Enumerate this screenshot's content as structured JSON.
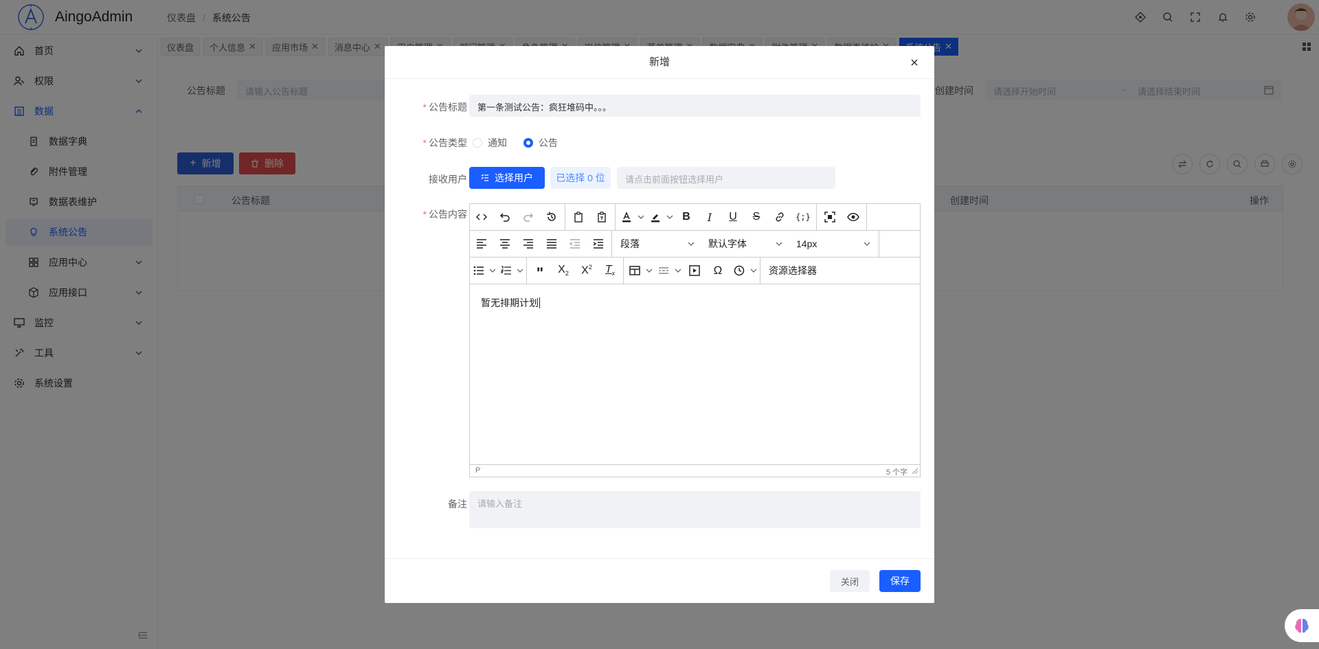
{
  "app": {
    "name": "AingoAdmin"
  },
  "breadcrumb": {
    "root": "仪表盘",
    "sep": "/",
    "current": "系统公告"
  },
  "header_icons": [
    "gitee-icon",
    "search-icon",
    "fullscreen-icon",
    "bell-icon",
    "gear-icon"
  ],
  "sidebar": {
    "items": [
      {
        "label": "首页",
        "icon": "home-icon"
      },
      {
        "label": "权限",
        "icon": "user-key-icon"
      },
      {
        "label": "数据",
        "icon": "list-icon"
      },
      {
        "label": "数据字典",
        "icon": "document-icon"
      },
      {
        "label": "附件管理",
        "icon": "paperclip-icon"
      },
      {
        "label": "数据表维护",
        "icon": "table-icon"
      },
      {
        "label": "系统公告",
        "icon": "bulb-icon"
      },
      {
        "label": "应用中心",
        "icon": "apps-icon"
      },
      {
        "label": "应用接口",
        "icon": "cube-icon"
      },
      {
        "label": "监控",
        "icon": "monitor-icon"
      },
      {
        "label": "工具",
        "icon": "tool-icon"
      },
      {
        "label": "系统设置",
        "icon": "gear-icon"
      }
    ]
  },
  "tabs": [
    {
      "label": "仪表盘",
      "closable": false
    },
    {
      "label": "个人信息",
      "closable": true
    },
    {
      "label": "应用市场",
      "closable": true
    },
    {
      "label": "消息中心",
      "closable": true
    },
    {
      "label": "用户管理",
      "closable": true
    },
    {
      "label": "部门管理",
      "closable": true
    },
    {
      "label": "角色管理",
      "closable": true
    },
    {
      "label": "岗位管理",
      "closable": true
    },
    {
      "label": "菜单管理",
      "closable": true
    },
    {
      "label": "数据字典",
      "closable": true
    },
    {
      "label": "附件管理",
      "closable": true
    },
    {
      "label": "数据表维护",
      "closable": true
    },
    {
      "label": "系统公告",
      "closable": true,
      "active": true
    }
  ],
  "search": {
    "title_label": "公告标题",
    "title_placeholder": "请输入公告标题",
    "created_label": "创建时间",
    "start_placeholder": "请选择开始时间",
    "range_sep": "-",
    "end_placeholder": "请选择结束时间"
  },
  "actions": {
    "add": "新增",
    "delete": "删除"
  },
  "table": {
    "columns": [
      "公告标题",
      "创建时间",
      "操作"
    ]
  },
  "dialog": {
    "title": "新增",
    "fields": {
      "title_label": "公告标题",
      "title_value": "第一条测试公告：疯狂堆码中。。。",
      "type_label": "公告类型",
      "type_options": [
        "通知",
        "公告"
      ],
      "type_selected": "公告",
      "receiver_label": "接收用户",
      "pick_button": "选择用户",
      "picked_count": "已选择 0 位",
      "receiver_placeholder": "请点击前面按钮选择用户",
      "content_label": "公告内容",
      "remark_label": "备注",
      "remark_placeholder": "请输入备注"
    },
    "editor": {
      "block_format": "段落",
      "font_family": "默认字体",
      "font_size": "14px",
      "resource_picker": "资源选择器",
      "content": "暂无排期计划",
      "status_path": "P",
      "word_count": "5 个字"
    },
    "footer": {
      "close": "关闭",
      "save": "保存"
    }
  },
  "colors": {
    "primary": "#1a5eff",
    "danger": "#e04d4d",
    "required": "#f56c6c"
  }
}
